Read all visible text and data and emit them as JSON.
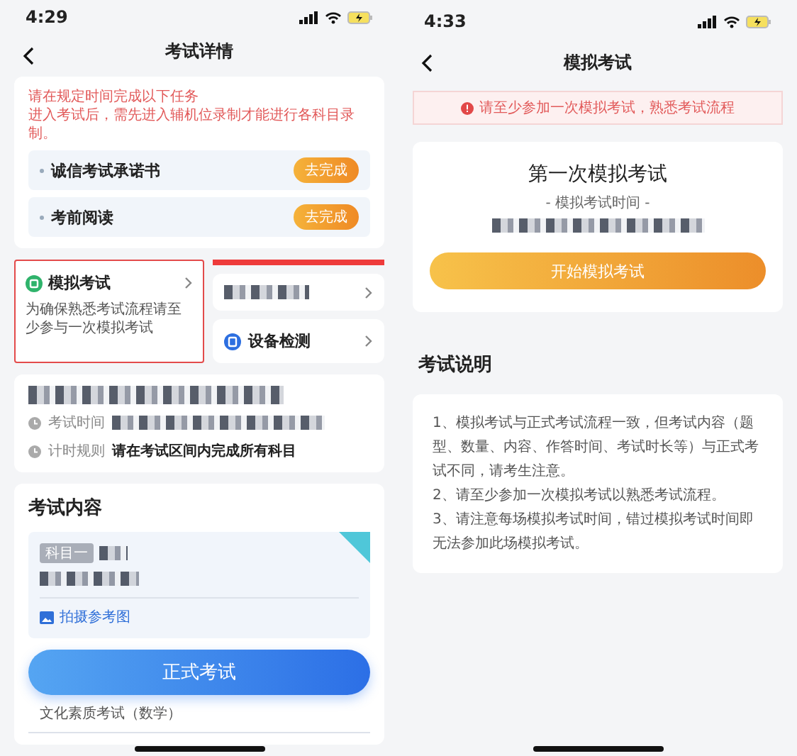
{
  "left_screen": {
    "status_bar": {
      "time": "4:29"
    },
    "nav": {
      "title": "考试详情"
    },
    "tasks": {
      "notice": [
        "请在规定时间完成以下任务",
        "进入考试后，需先进入辅机位录制才能进行各科目录制。"
      ],
      "items": [
        {
          "label": "诚信考试承诺书",
          "action": "去完成"
        },
        {
          "label": "考前阅读",
          "action": "去完成"
        }
      ]
    },
    "mock_card": {
      "title": "模拟考试",
      "description": "为确保熟悉考试流程请至少参与一次模拟考试",
      "highlighted": true
    },
    "device_card": {
      "title": "设备检测"
    },
    "info": {
      "rows": [
        {
          "label": "考试时间"
        },
        {
          "label": "计时规则",
          "value": "请在考试区间内完成所有科目"
        }
      ]
    },
    "content": {
      "title": "考试内容",
      "tag": "科目一",
      "photo_link": "拍摄参考图",
      "button": "正式考试",
      "subject": "文化素质考试（数学）"
    }
  },
  "right_screen": {
    "status_bar": {
      "time": "4:33"
    },
    "nav": {
      "title": "模拟考试"
    },
    "notice": "请至少参加一次模拟考试，熟悉考试流程",
    "exam_card": {
      "title": "第一次模拟考试",
      "subtitle": "- 模拟考试时间 -",
      "button": "开始模拟考试"
    },
    "section_title": "考试说明",
    "description": [
      "1、模拟考试与正式考试流程一致，但考试内容（题型、数量、内容、作答时间、考试时长等）与正式考试不同，请考生注意。",
      "2、请至少参加一次模拟考试以熟悉考试流程。",
      "3、请注意每场模拟考试时间，错过模拟考试时间即无法参加此场模拟考试。"
    ]
  }
}
